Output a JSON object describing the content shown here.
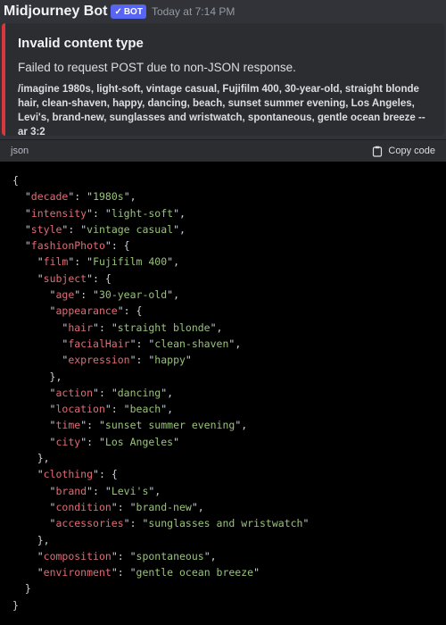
{
  "header": {
    "username": "Midjourney Bot",
    "bot_tag": "BOT",
    "timestamp": "Today at 7:14 PM"
  },
  "embed": {
    "title": "Invalid content type",
    "description": "Failed to request POST due to non-JSON response.",
    "prompt": "/imagine 1980s, light-soft, vintage casual, Fujifilm 400, 30-year-old, straight blonde hair, clean-shaven, happy, dancing, beach, sunset summer evening, Los Angeles, Levi's, brand-new, sunglasses and wristwatch, spontaneous, gentle ocean breeze --ar 3:2"
  },
  "code": {
    "language": "json",
    "copy_label": "Copy code",
    "lines": [
      {
        "indent": 0,
        "text": "{"
      },
      {
        "indent": 1,
        "key": "decade",
        "value": "1980s"
      },
      {
        "indent": 1,
        "key": "intensity",
        "value": "light-soft"
      },
      {
        "indent": 1,
        "key": "style",
        "value": "vintage casual"
      },
      {
        "indent": 1,
        "key": "fashionPhoto",
        "open": "{"
      },
      {
        "indent": 2,
        "key": "film",
        "value": "Fujifilm 400"
      },
      {
        "indent": 2,
        "key": "subject",
        "open": "{"
      },
      {
        "indent": 3,
        "key": "age",
        "value": "30-year-old"
      },
      {
        "indent": 3,
        "key": "appearance",
        "open": "{"
      },
      {
        "indent": 4,
        "key": "hair",
        "value": "straight blonde"
      },
      {
        "indent": 4,
        "key": "facialHair",
        "value": "clean-shaven"
      },
      {
        "indent": 4,
        "key": "expression",
        "value": "happy",
        "last": true
      },
      {
        "indent": 3,
        "text": "},"
      },
      {
        "indent": 3,
        "key": "action",
        "value": "dancing"
      },
      {
        "indent": 3,
        "key": "location",
        "value": "beach"
      },
      {
        "indent": 3,
        "key": "time",
        "value": "sunset summer evening"
      },
      {
        "indent": 3,
        "key": "city",
        "value": "Los Angeles",
        "last": true
      },
      {
        "indent": 2,
        "text": "},"
      },
      {
        "indent": 2,
        "key": "clothing",
        "open": "{"
      },
      {
        "indent": 3,
        "key": "brand",
        "value": "Levi's"
      },
      {
        "indent": 3,
        "key": "condition",
        "value": "brand-new"
      },
      {
        "indent": 3,
        "key": "accessories",
        "value": "sunglasses and wristwatch",
        "last": true
      },
      {
        "indent": 2,
        "text": "},"
      },
      {
        "indent": 2,
        "key": "composition",
        "value": "spontaneous"
      },
      {
        "indent": 2,
        "key": "environment",
        "value": "gentle ocean breeze",
        "last": true
      },
      {
        "indent": 1,
        "text": "}"
      },
      {
        "indent": 0,
        "text": "}"
      }
    ]
  },
  "colors": {
    "accent_bar": "#da373c",
    "bot_tag": "#5865f2",
    "json_key": "#e06c75",
    "json_string": "#98c379"
  }
}
